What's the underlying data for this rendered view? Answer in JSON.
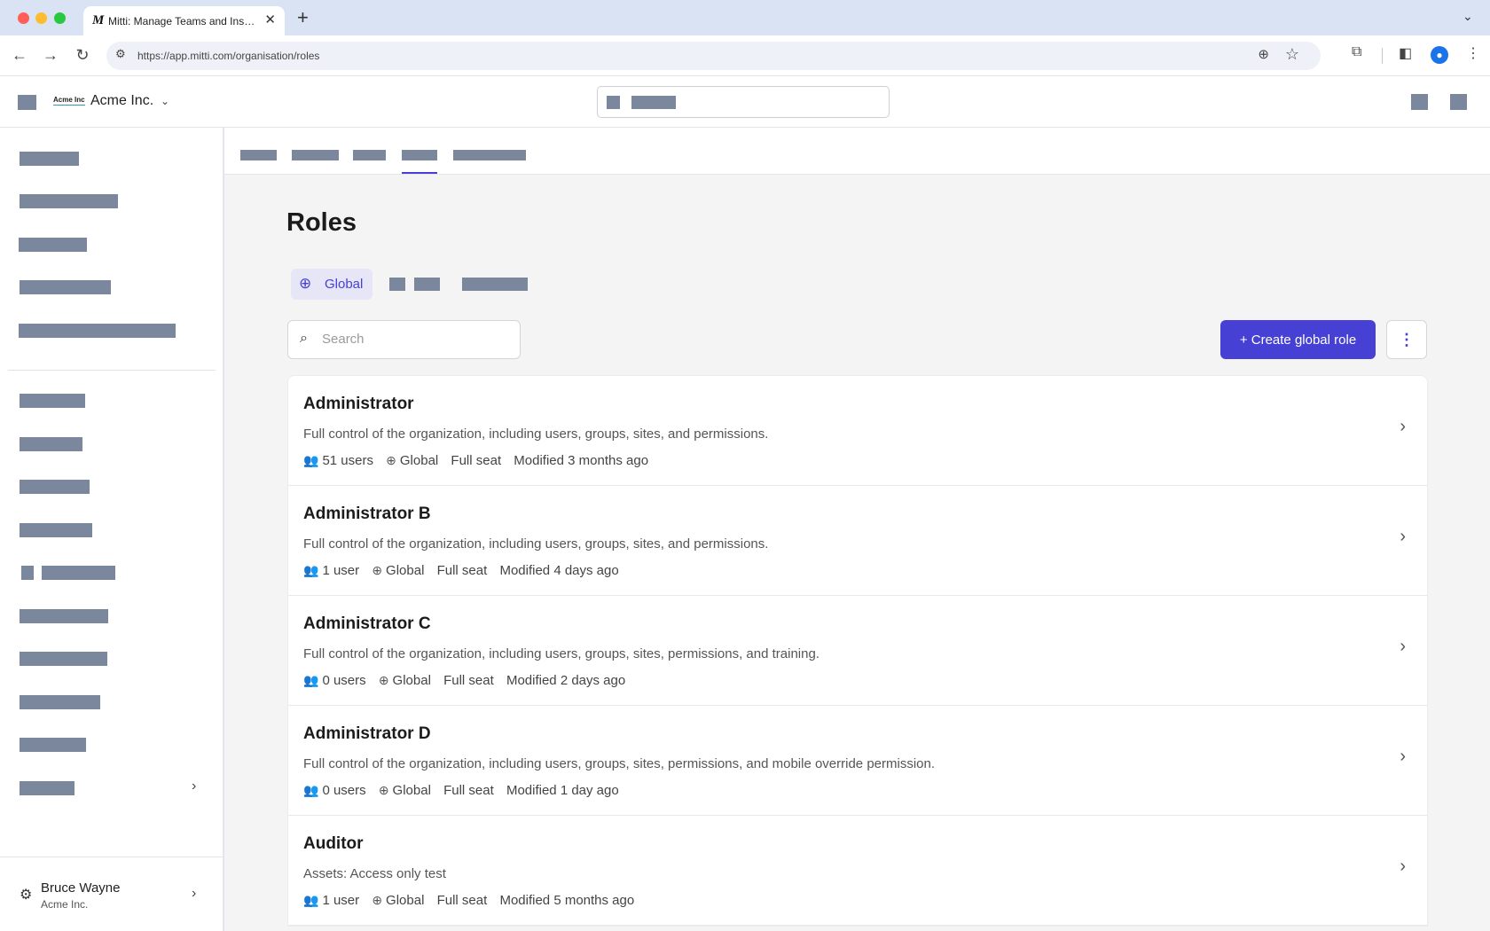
{
  "browser": {
    "tab_title": "Mitti: Manage Teams and Inspect...",
    "tab_favicon": "M",
    "new_tab": "+",
    "url": "https://app.mitti.com/organisation/roles"
  },
  "header": {
    "org_logo_text": "Acme Inc",
    "org_name": "Acme Inc."
  },
  "sidebar": {
    "user_name": "Bruce Wayne",
    "user_org": "Acme Inc."
  },
  "page": {
    "title": "Roles",
    "scope_tab": "Global",
    "search_placeholder": "Search",
    "create_label": "+ Create global role"
  },
  "roles": [
    {
      "name": "Administrator",
      "description": "Full control of the organization, including users, groups, sites, and permissions.",
      "users": "51 users",
      "scope": "Global",
      "seat": "Full seat",
      "modified": "Modified 3 months ago"
    },
    {
      "name": "Administrator B",
      "description": "Full control of the organization, including users, groups, sites, and permissions.",
      "users": "1 user",
      "scope": "Global",
      "seat": "Full seat",
      "modified": "Modified 4 days ago"
    },
    {
      "name": "Administrator C",
      "description": "Full control of the organization, including users, groups, sites, permissions, and training.",
      "users": "0 users",
      "scope": "Global",
      "seat": "Full seat",
      "modified": "Modified 2 days ago"
    },
    {
      "name": "Administrator D",
      "description": "Full control of the organization, including users, groups, sites, permissions, and mobile override permission.",
      "users": "0 users",
      "scope": "Global",
      "seat": "Full seat",
      "modified": "Modified 1 day ago"
    },
    {
      "name": "Auditor",
      "description": "Assets: Access only test",
      "users": "1 user",
      "scope": "Global",
      "seat": "Full seat",
      "modified": "Modified 5 months ago"
    }
  ],
  "icons": {
    "accent_color": "#4740d4",
    "users": "users-icon",
    "globe": "globe-icon",
    "chevron": "chevron-right-icon"
  }
}
